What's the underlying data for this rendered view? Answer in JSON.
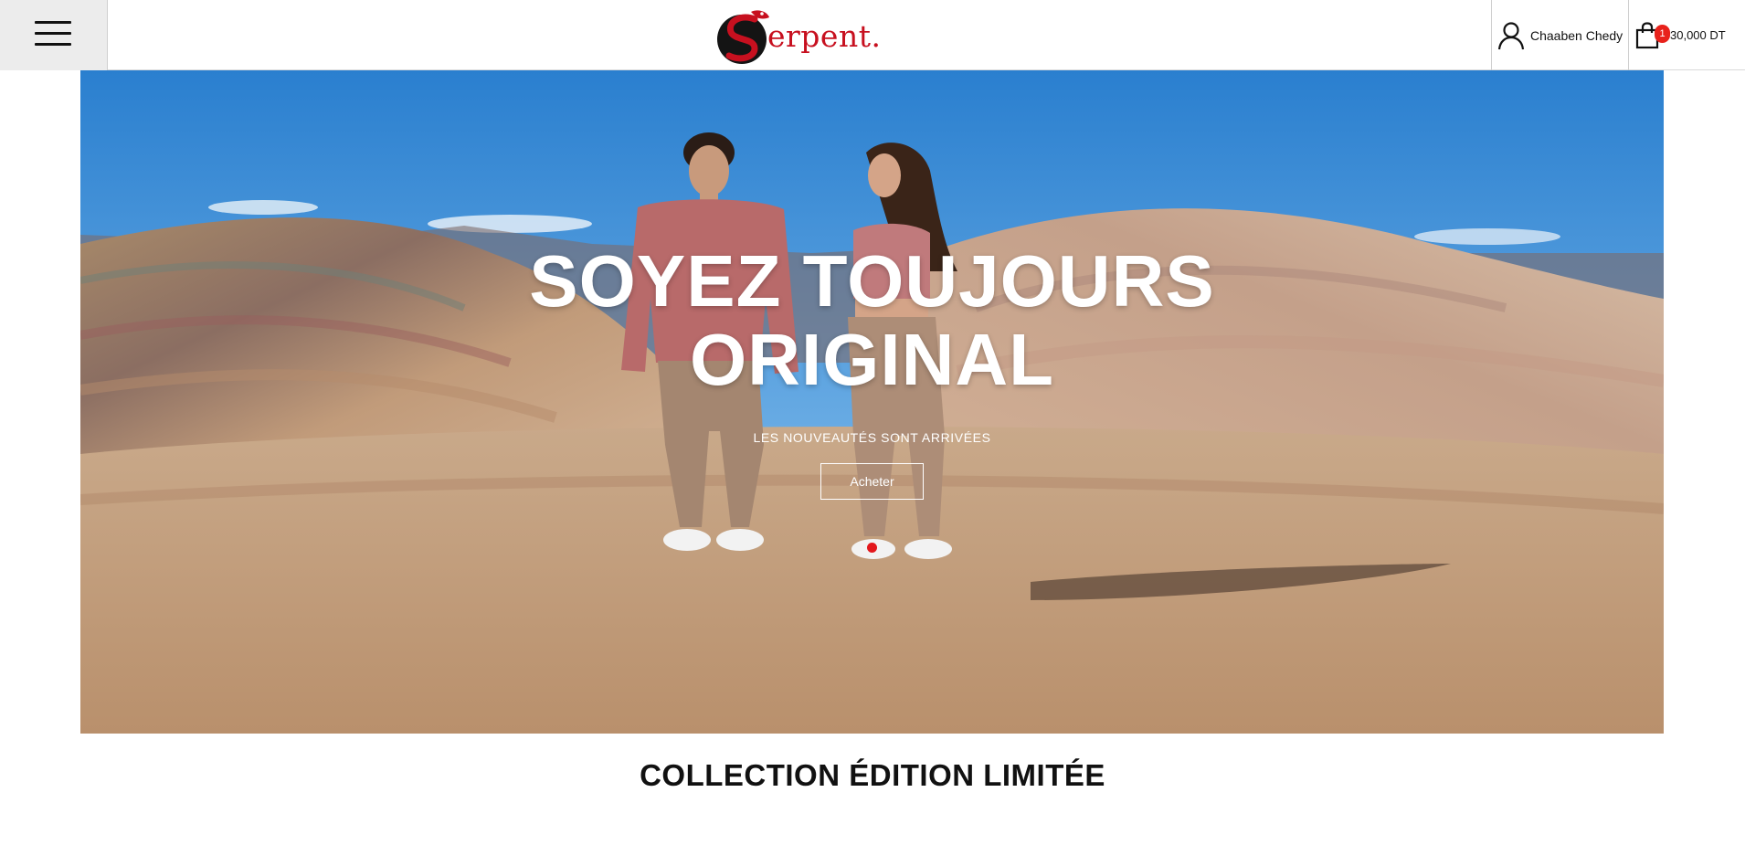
{
  "header": {
    "menu_icon": "hamburger-menu-icon",
    "logo": {
      "text": "erpent.",
      "emblem": "serpent-s-emblem",
      "color": "#c7101f"
    },
    "account": {
      "icon": "user-icon",
      "name": "Chaaben Chedy"
    },
    "cart": {
      "icon": "shopping-bag-icon",
      "count": "1",
      "total": "30,000 DT",
      "badge_color": "#e8221b"
    }
  },
  "hero": {
    "title_line1": "SOYEZ TOUJOURS",
    "title_line2": "ORIGINAL",
    "subtitle": "LES NOUVEAUTÉS SONT ARRIVÉES",
    "cta_label": "Acheter",
    "active_slide_dot_color": "#e3171c"
  },
  "section": {
    "title": "COLLECTION ÉDITION LIMITÉE"
  }
}
